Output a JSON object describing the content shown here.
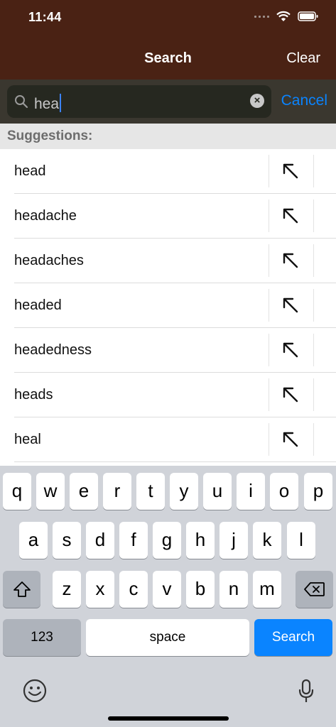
{
  "status_bar": {
    "time": "11:44"
  },
  "nav": {
    "title": "Search",
    "clear_label": "Clear"
  },
  "search": {
    "query": "hea",
    "cancel_label": "Cancel"
  },
  "suggestions_header": "Suggestions:",
  "suggestions": [
    "head",
    "headache",
    "headaches",
    "headed",
    "headedness",
    "heads",
    "heal"
  ],
  "keyboard": {
    "row1": [
      "q",
      "w",
      "e",
      "r",
      "t",
      "y",
      "u",
      "i",
      "o",
      "p"
    ],
    "row2": [
      "a",
      "s",
      "d",
      "f",
      "g",
      "h",
      "j",
      "k",
      "l"
    ],
    "row3": [
      "z",
      "x",
      "c",
      "v",
      "b",
      "n",
      "m"
    ],
    "numbers_label": "123",
    "space_label": "space",
    "search_label": "Search"
  },
  "colors": {
    "header_bg": "#4a2214",
    "accent": "#0a84ff"
  },
  "icons": [
    "wifi-icon",
    "battery-icon",
    "search-icon",
    "clear-text-icon",
    "arrow-up-left-icon",
    "shift-icon",
    "backspace-icon",
    "emoji-icon",
    "microphone-icon"
  ]
}
